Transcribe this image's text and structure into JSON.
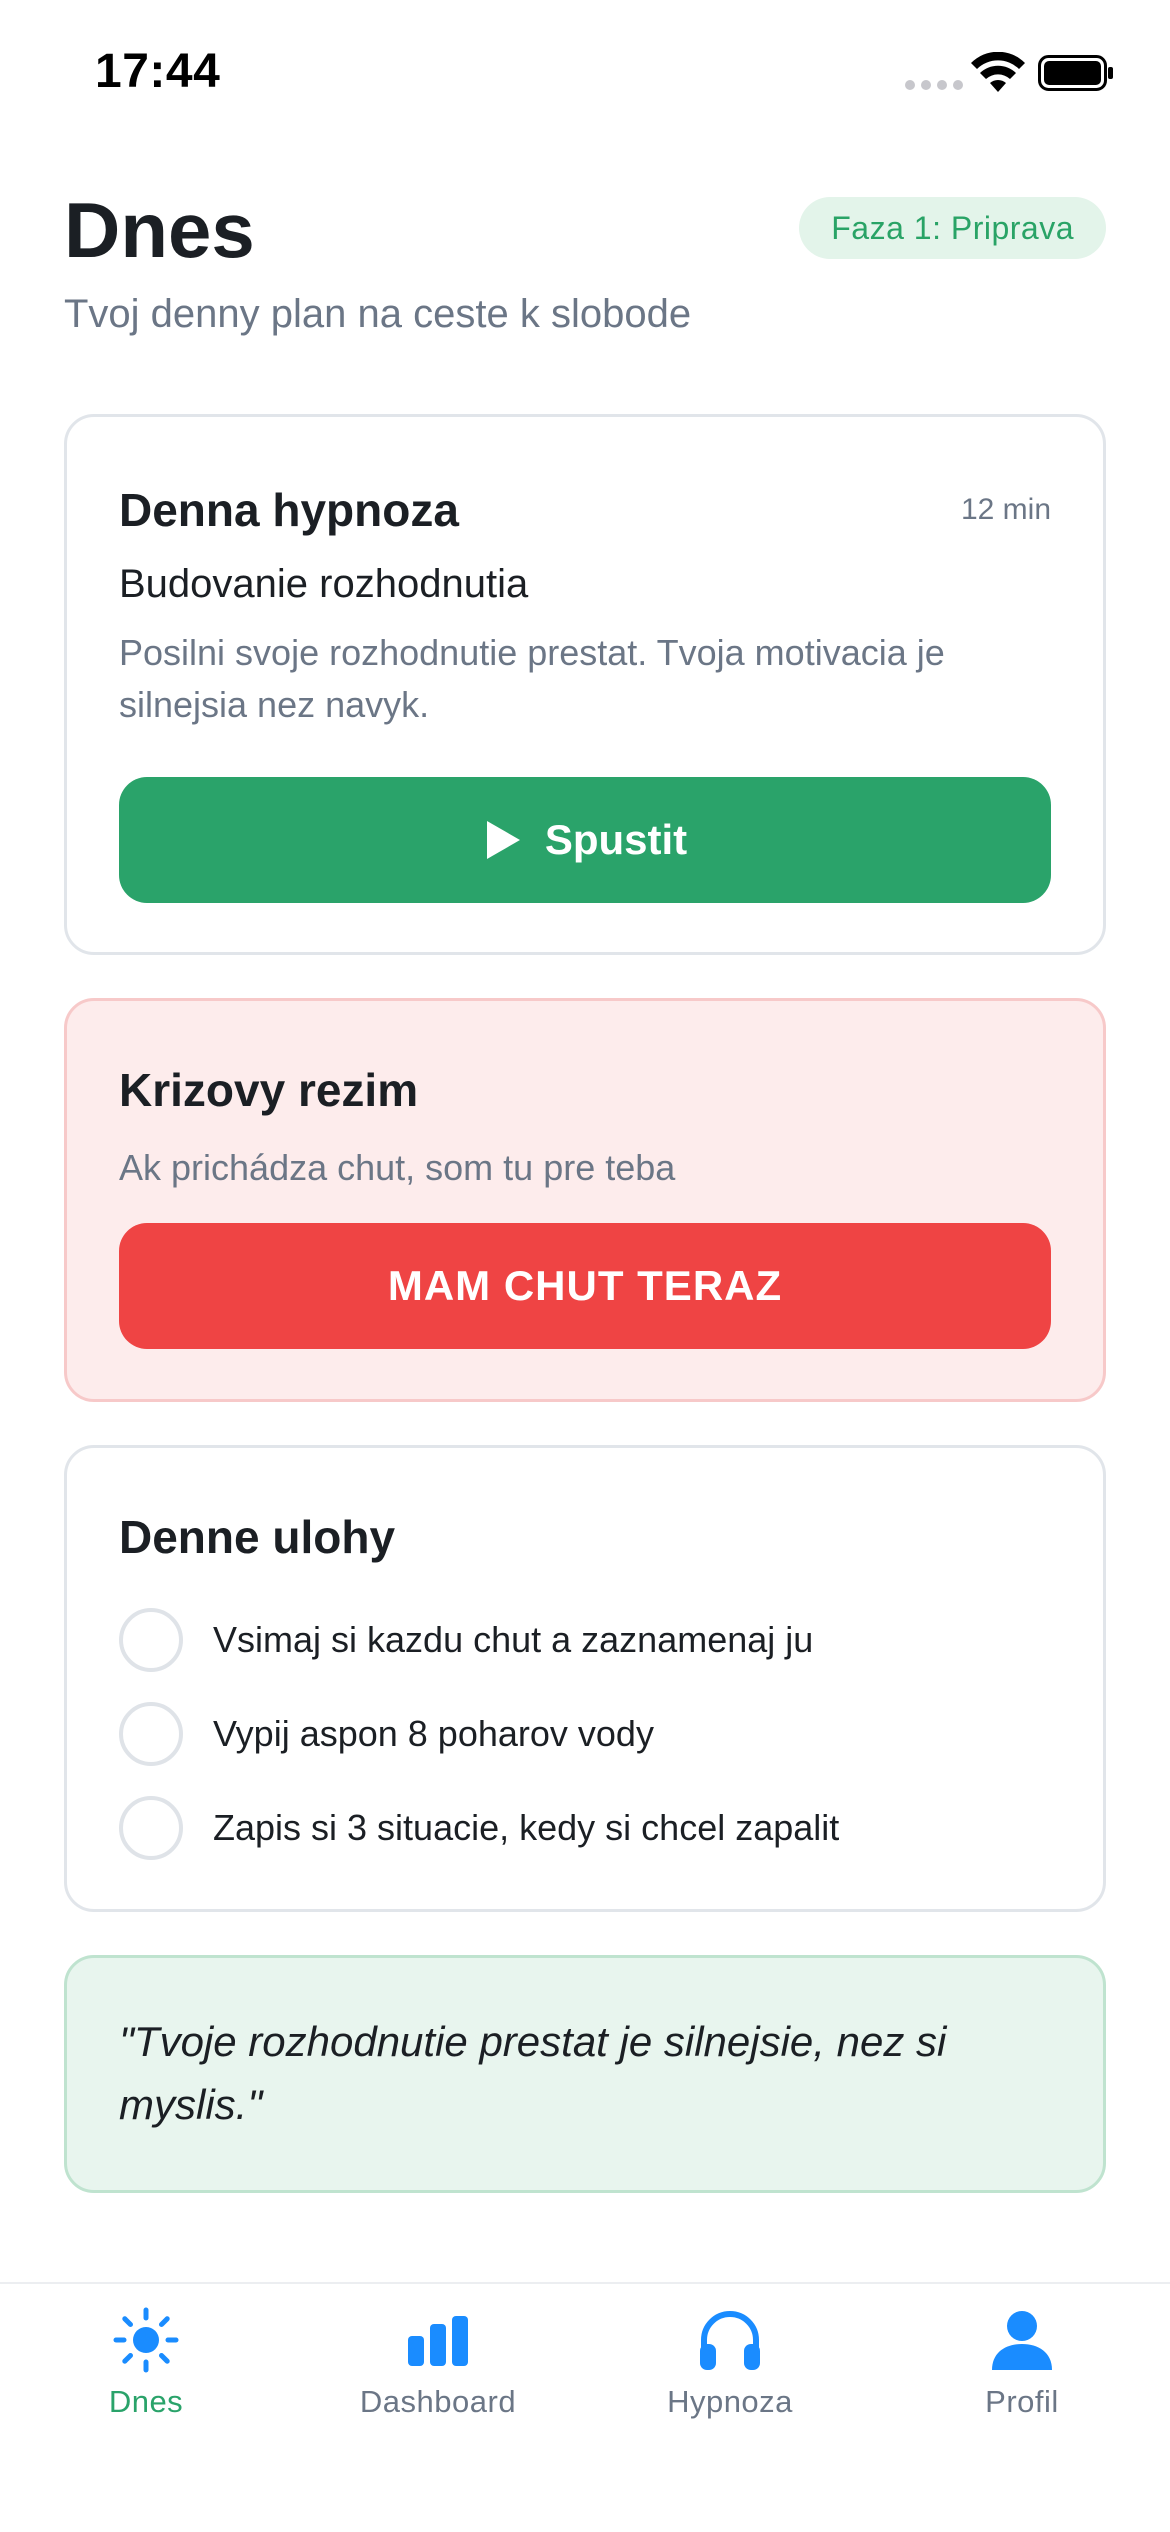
{
  "status_bar": {
    "time": "17:44"
  },
  "header": {
    "title": "Dnes",
    "subtitle": "Tvoj denny plan na ceste k slobode",
    "phase_badge": "Faza 1: Priprava"
  },
  "hypnosis_card": {
    "heading": "Denna hypnoza",
    "duration": "12 min",
    "session_title": "Budovanie rozhodnutia",
    "description": "Posilni svoje rozhodnutie prestat. Tvoja motivacia je silnejsia nez navyk.",
    "start_label": "Spustit",
    "icon": "play-icon"
  },
  "crisis_card": {
    "heading": "Krizovy rezim",
    "subtitle": "Ak prichádza chut, som tu pre teba",
    "button_label": "MAM CHUT TERAZ"
  },
  "tasks_card": {
    "heading": "Denne ulohy",
    "items": [
      {
        "label": "Vsimaj si kazdu chut a zaznamenaj ju",
        "checked": false
      },
      {
        "label": "Vypij aspon 8 poharov vody",
        "checked": false
      },
      {
        "label": "Zapis si 3 situacie, kedy si chcel zapalit",
        "checked": false
      }
    ]
  },
  "quote_card": {
    "text": "\"Tvoje rozhodnutie prestat je silnejsie, nez si myslis.\""
  },
  "tab_bar": {
    "active": "Dnes",
    "tabs": [
      {
        "label": "Dnes",
        "icon": "sun-icon"
      },
      {
        "label": "Dashboard",
        "icon": "bar-chart-icon"
      },
      {
        "label": "Hypnoza",
        "icon": "headphones-icon"
      },
      {
        "label": "Profil",
        "icon": "person-icon"
      }
    ]
  },
  "colors": {
    "accent_green": "#2aa36a",
    "crisis_red": "#ef4444",
    "tab_blue": "#1a8cff",
    "muted_text": "#6b7686"
  }
}
